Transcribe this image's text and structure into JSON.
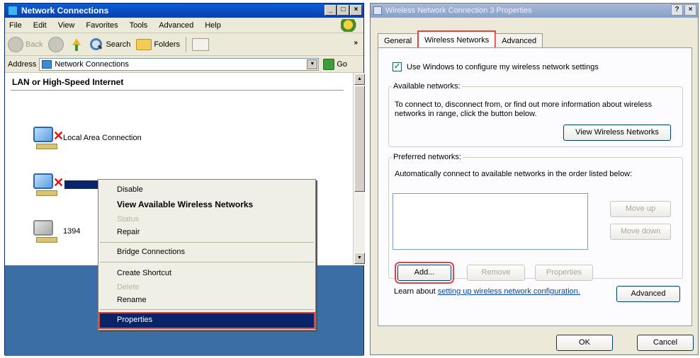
{
  "left_window": {
    "title": "Network Connections",
    "caption_buttons": [
      "_",
      "□",
      "×"
    ],
    "menu": [
      "File",
      "Edit",
      "View",
      "Favorites",
      "Tools",
      "Advanced",
      "Help"
    ],
    "toolbar": {
      "back": "Back",
      "search": "Search",
      "folders": "Folders",
      "more": "»"
    },
    "address": {
      "label": "Address",
      "value": "Network Connections",
      "go": "Go"
    },
    "section_header": "LAN or High-Speed Internet",
    "connections": [
      {
        "label": "Local Area Connection"
      },
      {
        "label": ""
      },
      {
        "label": "1394"
      }
    ]
  },
  "context_menu": {
    "items": [
      {
        "label": "Disable",
        "style": "normal"
      },
      {
        "label": "View Available Wireless Networks",
        "style": "bold"
      },
      {
        "label": "Status",
        "style": "disabled"
      },
      {
        "label": "Repair",
        "style": "normal"
      },
      {
        "label": "Bridge Connections",
        "style": "normal"
      },
      {
        "label": "Create Shortcut",
        "style": "normal"
      },
      {
        "label": "Delete",
        "style": "disabled"
      },
      {
        "label": "Rename",
        "style": "normal"
      },
      {
        "label": "Properties",
        "style": "highlighted"
      }
    ]
  },
  "right_window": {
    "title": "Wireless Network Connection 3 Properties",
    "help_button": "?",
    "close_button": "×",
    "tabs": [
      "General",
      "Wireless Networks",
      "Advanced"
    ],
    "active_tab": "Wireless Networks",
    "use_windows_checkbox": {
      "label": "Use Windows to configure my wireless network settings",
      "checked": true
    },
    "available_networks": {
      "legend": "Available networks:",
      "text": "To connect to, disconnect from, or find out more information about wireless networks in range, click the button below.",
      "button": "View Wireless Networks"
    },
    "preferred_networks": {
      "legend": "Preferred networks:",
      "text": "Automatically connect to available networks in the order listed below:",
      "move_up": "Move up",
      "move_down": "Move down",
      "add": "Add...",
      "remove": "Remove",
      "properties": "Properties"
    },
    "learn": {
      "prefix": "Learn about ",
      "link": "setting up wireless network configuration.",
      "advanced_button": "Advanced"
    },
    "ok": "OK",
    "cancel": "Cancel"
  }
}
